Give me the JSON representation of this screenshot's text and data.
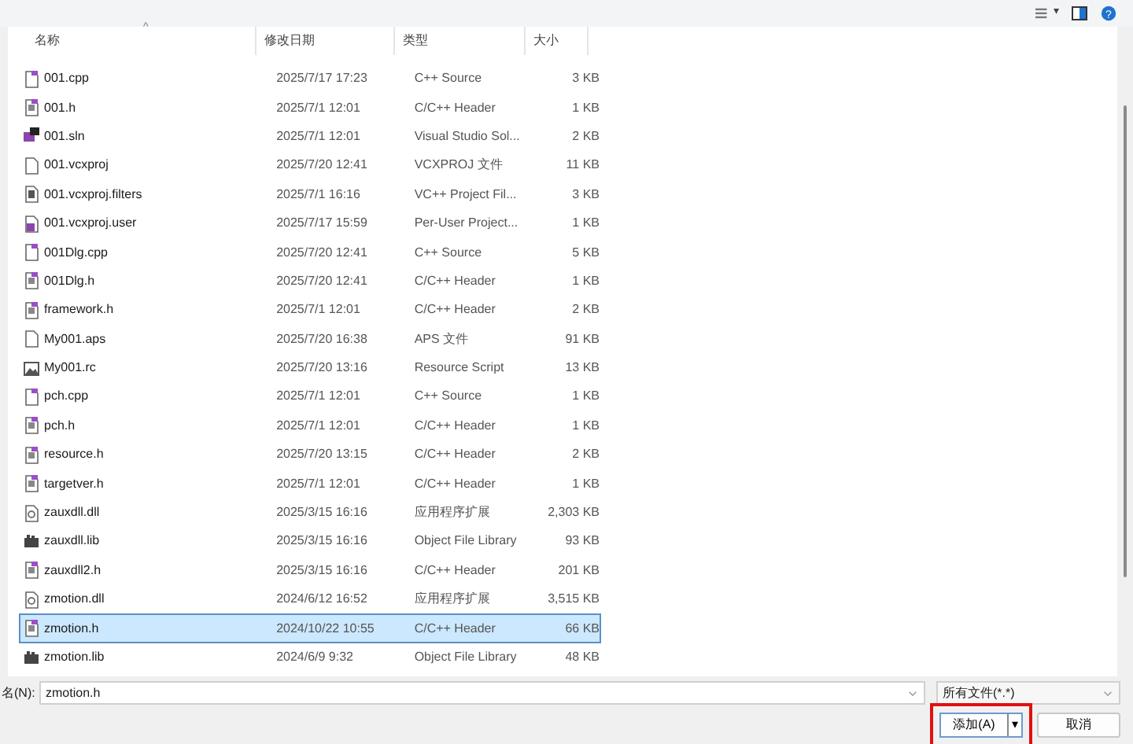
{
  "toolbar": {
    "view_menu_caret": "▾",
    "help_glyph": "?"
  },
  "columns": [
    {
      "label": "名称",
      "sort_caret": "^"
    },
    {
      "label": "修改日期"
    },
    {
      "label": "类型"
    },
    {
      "label": "大小"
    }
  ],
  "files": [
    {
      "kind": "cpp",
      "name": "001.cpp",
      "date": "2025/7/17 17:23",
      "type": "C++ Source",
      "size": "3 KB",
      "selected": false
    },
    {
      "kind": "header",
      "name": "001.h",
      "date": "2025/7/1 12:01",
      "type": "C/C++ Header",
      "size": "1 KB",
      "selected": false
    },
    {
      "kind": "sln",
      "name": "001.sln",
      "date": "2025/7/1 12:01",
      "type": "Visual Studio Sol...",
      "size": "2 KB",
      "selected": false
    },
    {
      "kind": "blank",
      "name": "001.vcxproj",
      "date": "2025/7/20 12:41",
      "type": "VCXPROJ 文件",
      "size": "11 KB",
      "selected": false
    },
    {
      "kind": "filters",
      "name": "001.vcxproj.filters",
      "date": "2025/7/1 16:16",
      "type": "VC++ Project Fil...",
      "size": "3 KB",
      "selected": false
    },
    {
      "kind": "user",
      "name": "001.vcxproj.user",
      "date": "2025/7/17 15:59",
      "type": "Per-User Project...",
      "size": "1 KB",
      "selected": false
    },
    {
      "kind": "cpp",
      "name": "001Dlg.cpp",
      "date": "2025/7/20 12:41",
      "type": "C++ Source",
      "size": "5 KB",
      "selected": false
    },
    {
      "kind": "header",
      "name": "001Dlg.h",
      "date": "2025/7/20 12:41",
      "type": "C/C++ Header",
      "size": "1 KB",
      "selected": false
    },
    {
      "kind": "header",
      "name": "framework.h",
      "date": "2025/7/1 12:01",
      "type": "C/C++ Header",
      "size": "2 KB",
      "selected": false
    },
    {
      "kind": "blank",
      "name": "My001.aps",
      "date": "2025/7/20 16:38",
      "type": "APS 文件",
      "size": "91 KB",
      "selected": false
    },
    {
      "kind": "image",
      "name": "My001.rc",
      "date": "2025/7/20 13:16",
      "type": "Resource Script",
      "size": "13 KB",
      "selected": false
    },
    {
      "kind": "cpp",
      "name": "pch.cpp",
      "date": "2025/7/1 12:01",
      "type": "C++ Source",
      "size": "1 KB",
      "selected": false
    },
    {
      "kind": "header",
      "name": "pch.h",
      "date": "2025/7/1 12:01",
      "type": "C/C++ Header",
      "size": "1 KB",
      "selected": false
    },
    {
      "kind": "header",
      "name": "resource.h",
      "date": "2025/7/20 13:15",
      "type": "C/C++ Header",
      "size": "2 KB",
      "selected": false
    },
    {
      "kind": "header",
      "name": "targetver.h",
      "date": "2025/7/1 12:01",
      "type": "C/C++ Header",
      "size": "1 KB",
      "selected": false
    },
    {
      "kind": "dll",
      "name": "zauxdll.dll",
      "date": "2025/3/15 16:16",
      "type": "应用程序扩展",
      "size": "2,303 KB",
      "selected": false
    },
    {
      "kind": "lib",
      "name": "zauxdll.lib",
      "date": "2025/3/15 16:16",
      "type": "Object File Library",
      "size": "93 KB",
      "selected": false
    },
    {
      "kind": "header",
      "name": "zauxdll2.h",
      "date": "2025/3/15 16:16",
      "type": "C/C++ Header",
      "size": "201 KB",
      "selected": false
    },
    {
      "kind": "dll",
      "name": "zmotion.dll",
      "date": "2024/6/12 16:52",
      "type": "应用程序扩展",
      "size": "3,515 KB",
      "selected": false
    },
    {
      "kind": "header",
      "name": "zmotion.h",
      "date": "2024/10/22 10:55",
      "type": "C/C++ Header",
      "size": "66 KB",
      "selected": true
    },
    {
      "kind": "lib",
      "name": "zmotion.lib",
      "date": "2024/6/9 9:32",
      "type": "Object File Library",
      "size": "48 KB",
      "selected": false
    }
  ],
  "filename": {
    "label": "名(N):",
    "value": "zmotion.h"
  },
  "filter": {
    "value": "所有文件(*.*)"
  },
  "buttons": [
    {
      "label": "添加(A)",
      "split_caret": "▾",
      "highlighted": true
    },
    {
      "label": "取消",
      "highlighted": false
    }
  ]
}
